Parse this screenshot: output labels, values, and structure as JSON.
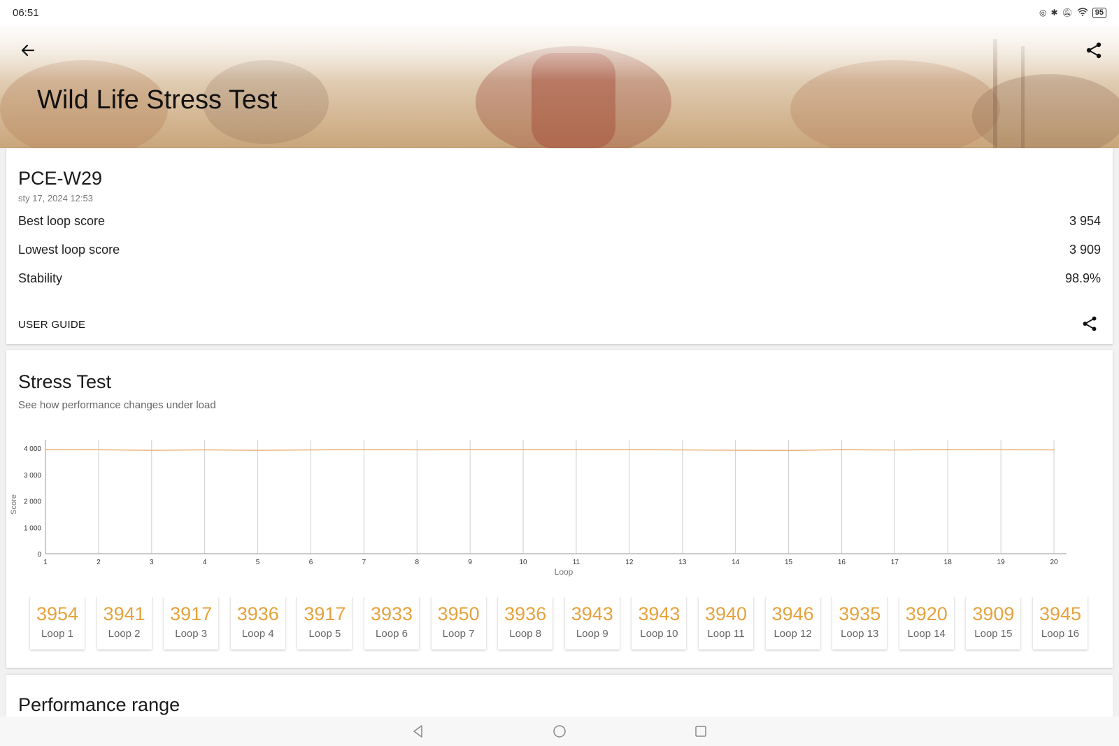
{
  "status_bar": {
    "time": "06:51",
    "battery": "95"
  },
  "header": {
    "title": "Wild Life Stress Test"
  },
  "summary": {
    "device": "PCE-W29",
    "date": "sty 17, 2024 12:53",
    "rows": [
      {
        "label": "Best loop score",
        "value": "3 954"
      },
      {
        "label": "Lowest loop score",
        "value": "3 909"
      },
      {
        "label": "Stability",
        "value": "98.9%"
      }
    ],
    "user_guide": "USER GUIDE"
  },
  "stress": {
    "title": "Stress Test",
    "subtitle": "See how performance changes under load"
  },
  "chart_data": {
    "type": "line",
    "xlabel": "Loop",
    "ylabel": "Score",
    "ylim": [
      0,
      4000
    ],
    "yticks": [
      "0",
      "1 000",
      "2 000",
      "3 000",
      "4 000"
    ],
    "x": [
      1,
      2,
      3,
      4,
      5,
      6,
      7,
      8,
      9,
      10,
      11,
      12,
      13,
      14,
      15,
      16,
      17,
      18,
      19,
      20
    ],
    "series": [
      {
        "values": [
          3954,
          3941,
          3917,
          3936,
          3917,
          3933,
          3950,
          3936,
          3943,
          3943,
          3940,
          3946,
          3935,
          3920,
          3909,
          3945,
          3930,
          3950,
          3942,
          3938
        ]
      }
    ],
    "grid": true,
    "line_color": "#e8b27a"
  },
  "loops": [
    {
      "score": "3954",
      "label": "Loop 1"
    },
    {
      "score": "3941",
      "label": "Loop 2"
    },
    {
      "score": "3917",
      "label": "Loop 3"
    },
    {
      "score": "3936",
      "label": "Loop 4"
    },
    {
      "score": "3917",
      "label": "Loop 5"
    },
    {
      "score": "3933",
      "label": "Loop 6"
    },
    {
      "score": "3950",
      "label": "Loop 7"
    },
    {
      "score": "3936",
      "label": "Loop 8"
    },
    {
      "score": "3943",
      "label": "Loop 9"
    },
    {
      "score": "3943",
      "label": "Loop 10"
    },
    {
      "score": "3940",
      "label": "Loop 11"
    },
    {
      "score": "3946",
      "label": "Loop 12"
    },
    {
      "score": "3935",
      "label": "Loop 13"
    },
    {
      "score": "3920",
      "label": "Loop 14"
    },
    {
      "score": "3909",
      "label": "Loop 15"
    },
    {
      "score": "3945",
      "label": "Loop 16"
    }
  ],
  "performance": {
    "title": "Performance range"
  },
  "colors": {
    "accent": "#e6a23c",
    "chart_line": "#e8b27a"
  },
  "icons": [
    "back-arrow-icon",
    "share-icon",
    "nav-back-icon",
    "nav-home-icon",
    "nav-recents-icon"
  ]
}
